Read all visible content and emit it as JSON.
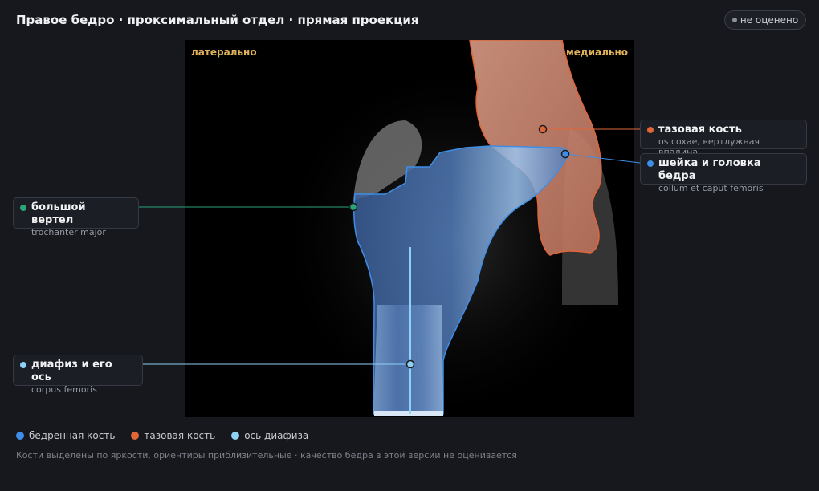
{
  "header": {
    "title": "Правое бедро · проксимальный отдел · прямая проекция",
    "status_badge": "не оценено"
  },
  "image": {
    "lateral_label": "латерально",
    "medial_label": "медиально"
  },
  "callouts": [
    {
      "name": "тазовая кость",
      "latin": "os coxae, вертлужная впадина",
      "color": "#e0663a"
    },
    {
      "name": "шейка и головка бедра",
      "latin": "collum et caput femoris",
      "color": "#3e8ee8"
    },
    {
      "name": "большой вертел",
      "latin": "trochanter major",
      "color": "#2aa57a"
    },
    {
      "name": "диафиз и его ось",
      "latin": "corpus femoris",
      "color": "#8fd0f5"
    }
  ],
  "legend": [
    {
      "label": "бедренная кость",
      "color": "#3e8ee8"
    },
    {
      "label": "тазовая кость",
      "color": "#e0663a"
    },
    {
      "label": "ось диафиза",
      "color": "#8fd0f5"
    }
  ],
  "footnote": "Кости выделены по яркости, ориентиры приблизительные · качество бедра в этой версии не оценивается"
}
